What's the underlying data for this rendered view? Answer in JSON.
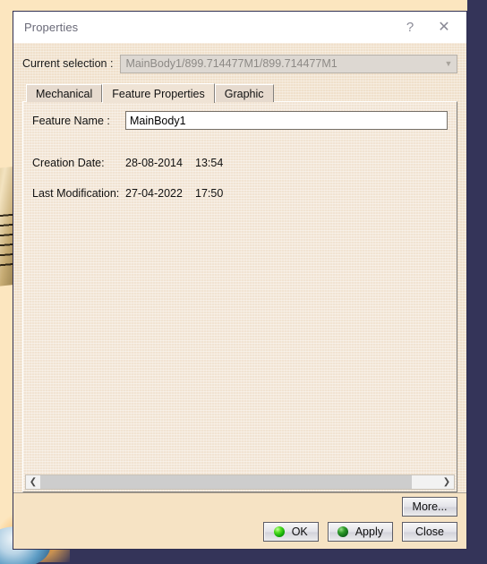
{
  "window": {
    "title": "Properties",
    "help_icon": "question-mark-icon",
    "close_icon": "close-x-icon",
    "help_glyph": "?",
    "close_glyph": "✕"
  },
  "selection": {
    "label": "Current selection :",
    "value": "MainBody1/899.714477M1/899.714477M1",
    "arrow_glyph": "▼",
    "disabled": "true"
  },
  "tabs": [
    {
      "label": "Mechanical",
      "active": "false"
    },
    {
      "label": "Feature Properties",
      "active": "true"
    },
    {
      "label": "Graphic",
      "active": "false"
    }
  ],
  "feature_properties": {
    "feature_name_label": "Feature Name :",
    "feature_name_value": "MainBody1",
    "feature_name_placeholder": "",
    "creation_date_label": "Creation Date:",
    "creation_date_value": "28-08-2014",
    "creation_time_value": "13:54",
    "last_modification_label": "Last Modification:",
    "last_modification_value": "27-04-2022",
    "last_modification_time_value": "17:50"
  },
  "scrollbar": {
    "left_arrow_glyph": "❮",
    "right_arrow_glyph": "❯"
  },
  "footer": {
    "more_label": "More...",
    "ok_label": "OK",
    "apply_label": "Apply",
    "close_label": "Close"
  },
  "colors": {
    "desktop_background": "#343459",
    "cad_canvas": "#fce6bf",
    "dialog_frame": "#f6e3c4",
    "titlebar": "#ffffff",
    "tab_page": "#f1e3d2",
    "ok_sphere": "#12aa07",
    "apply_sphere": "#11691a",
    "disabled_text": "#8d8a86"
  }
}
